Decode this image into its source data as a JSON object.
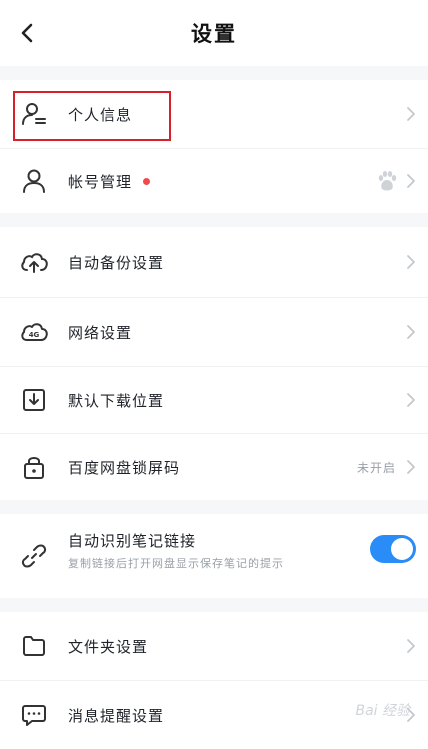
{
  "header": {
    "title": "设置",
    "back_icon": "chevron-left-icon"
  },
  "rows": [
    {
      "label": "个人信息",
      "icon": "person-card-icon"
    },
    {
      "label": "帐号管理",
      "icon": "person-icon",
      "badge": "red-dot",
      "right_icon": "baidu-paw-icon"
    },
    {
      "label": "自动备份设置",
      "icon": "cloud-upload-icon"
    },
    {
      "label": "网络设置",
      "icon": "cloud-4g-icon"
    },
    {
      "label": "默认下载位置",
      "icon": "download-box-icon"
    },
    {
      "label": "百度网盘锁屏码",
      "icon": "lock-icon",
      "right_text": "未开启"
    },
    {
      "label": "自动识别笔记链接",
      "icon": "link-icon",
      "sublabel": "复制链接后打开网盘显示保存笔记的提示",
      "toggle_on": true
    },
    {
      "label": "文件夹设置",
      "icon": "folder-icon"
    },
    {
      "label": "消息提醒设置",
      "icon": "message-icon"
    }
  ],
  "colors": {
    "accent": "#2a8df7",
    "highlight": "#d8202c",
    "badge": "#f04a4a"
  },
  "watermark": "Bai 经验"
}
